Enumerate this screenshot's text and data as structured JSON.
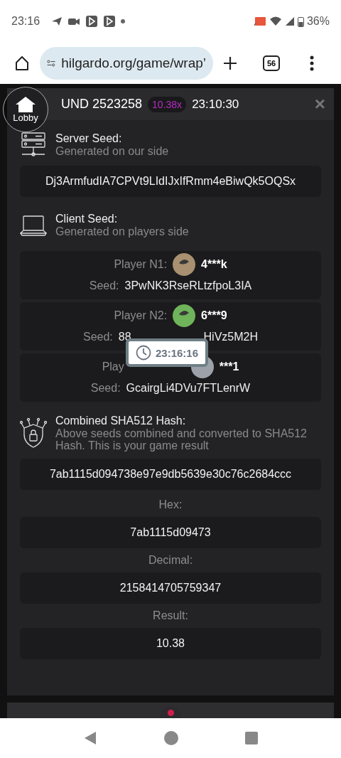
{
  "status_bar": {
    "time": "23:16",
    "battery": "36%"
  },
  "browser": {
    "url": "hilgardo.org/game/wrap’",
    "tab_count": "56"
  },
  "lobby": {
    "label": "Lobby"
  },
  "header": {
    "title": "UND 2523258",
    "multiplier": "10.38x",
    "time": "23:10:30",
    "close": "×"
  },
  "server_seed": {
    "title": "Server Seed:",
    "subtitle": "Generated on our side",
    "value": "Dj3ArmfudIA7CPVt9LIdIJxIfRmm4eBiwQk5OQSx"
  },
  "client_seed": {
    "title": "Client Seed:",
    "subtitle": "Generated on players side"
  },
  "players": [
    {
      "label_parts": [
        "Player N1:"
      ],
      "name": "4***k",
      "color": "#a89070",
      "seed_label": "Seed:",
      "seed_parts": [
        "3PwNK3RseRLtzfpoL3IA"
      ]
    },
    {
      "label_parts": [
        "Player N2:"
      ],
      "name": "6***9",
      "color": "#6fb35a",
      "seed_label": "Seed:",
      "seed_parts": [
        "88",
        "HiVz5M2H"
      ]
    },
    {
      "label_parts": [
        "Play"
      ],
      "label_cut": true,
      "name": "***1",
      "color": "#9da2aa",
      "seed_label": "Seed:",
      "seed_parts": [
        "GcairgLi4DVu7FTLenrW"
      ]
    }
  ],
  "clock_overlay": {
    "time": "23:16:16"
  },
  "hash": {
    "title": "Combined SHA512 Hash:",
    "subtitle": "Above seeds combined and converted to SHA512 Hash. This is your game result",
    "value": "7ab1115d094738e97e9db5639e30c76c2684ccc"
  },
  "results": [
    {
      "label": "Hex:",
      "value": "7ab1115d09473"
    },
    {
      "label": "Decimal:",
      "value": "2158414705759347"
    },
    {
      "label": "Result:",
      "value": "10.38"
    }
  ]
}
